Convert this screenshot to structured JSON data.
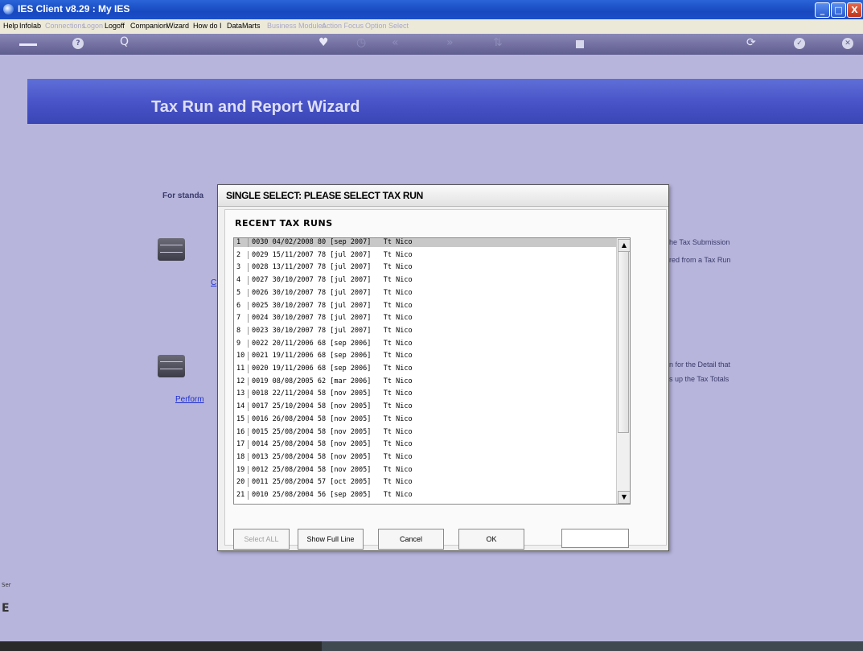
{
  "window": {
    "title": "IES Client v8.29 : My IES",
    "buttons": {
      "minimize": "_",
      "maximize": "□",
      "close": "X"
    }
  },
  "menu": [
    {
      "label": "Help",
      "enabled": true
    },
    {
      "label": "Infolab",
      "enabled": true
    },
    {
      "label": "Connections",
      "enabled": false
    },
    {
      "label": "Logon",
      "enabled": false
    },
    {
      "label": "Logoff",
      "enabled": true
    },
    {
      "label": "Companion",
      "enabled": true
    },
    {
      "label": "Wizard",
      "enabled": true
    },
    {
      "label": "How do I",
      "enabled": true
    },
    {
      "label": "DataMarts",
      "enabled": true
    },
    {
      "label": "Business Modules",
      "enabled": false
    },
    {
      "label": "Action Focus",
      "enabled": false
    },
    {
      "label": "Option Select",
      "enabled": false
    }
  ],
  "toolbar": {
    "help": "?",
    "search": "Q",
    "favorite": "♥",
    "history": "◷",
    "back": "«",
    "forward": "»",
    "step": "⇅",
    "refresh": "⟳",
    "ok": "✓",
    "close": "✕"
  },
  "page": {
    "banner_title": "Tax Run and Report Wizard",
    "intro_text": "For standa",
    "right_text_1": "he Tax Submission",
    "right_text_2": "red from a Tax Run",
    "right_text_3": "n for the Detail that",
    "right_text_4": "s up the Tax Totals",
    "link_1": "C",
    "link_2": "Perform",
    "side_text": "Ser",
    "side_text_2": "E"
  },
  "dialog": {
    "title": "SINGLE SELECT: PLEASE SELECT TAX RUN",
    "subtitle": "RECENT TAX RUNS",
    "rows": [
      {
        "num": "1",
        "text": "0030 04/02/2008 80 [sep 2007]   Tt Nico"
      },
      {
        "num": "2",
        "text": "0029 15/11/2007 78 [jul 2007]   Tt Nico"
      },
      {
        "num": "3",
        "text": "0028 13/11/2007 78 [jul 2007]   Tt Nico"
      },
      {
        "num": "4",
        "text": "0027 30/10/2007 78 [jul 2007]   Tt Nico"
      },
      {
        "num": "5",
        "text": "0026 30/10/2007 78 [jul 2007]   Tt Nico"
      },
      {
        "num": "6",
        "text": "0025 30/10/2007 78 [jul 2007]   Tt Nico"
      },
      {
        "num": "7",
        "text": "0024 30/10/2007 78 [jul 2007]   Tt Nico"
      },
      {
        "num": "8",
        "text": "0023 30/10/2007 78 [jul 2007]   Tt Nico"
      },
      {
        "num": "9",
        "text": "0022 20/11/2006 68 [sep 2006]   Tt Nico"
      },
      {
        "num": "10",
        "text": "0021 19/11/2006 68 [sep 2006]   Tt Nico"
      },
      {
        "num": "11",
        "text": "0020 19/11/2006 68 [sep 2006]   Tt Nico"
      },
      {
        "num": "12",
        "text": "0019 08/08/2005 62 [mar 2006]   Tt Nico"
      },
      {
        "num": "13",
        "text": "0018 22/11/2004 58 [nov 2005]   Tt Nico"
      },
      {
        "num": "14",
        "text": "0017 25/10/2004 58 [nov 2005]   Tt Nico"
      },
      {
        "num": "15",
        "text": "0016 26/08/2004 58 [nov 2005]   Tt Nico"
      },
      {
        "num": "16",
        "text": "0015 25/08/2004 58 [nov 2005]   Tt Nico"
      },
      {
        "num": "17",
        "text": "0014 25/08/2004 58 [nov 2005]   Tt Nico"
      },
      {
        "num": "18",
        "text": "0013 25/08/2004 58 [nov 2005]   Tt Nico"
      },
      {
        "num": "19",
        "text": "0012 25/08/2004 58 [nov 2005]   Tt Nico"
      },
      {
        "num": "20",
        "text": "0011 25/08/2004 57 [oct 2005]   Tt Nico"
      },
      {
        "num": "21",
        "text": "0010 25/08/2004 56 [sep 2005]   Tt Nico"
      }
    ],
    "buttons": {
      "select_all": "Select ALL",
      "show_full_line": "Show Full Line",
      "cancel": "Cancel",
      "ok": "OK"
    },
    "input_value": ""
  }
}
